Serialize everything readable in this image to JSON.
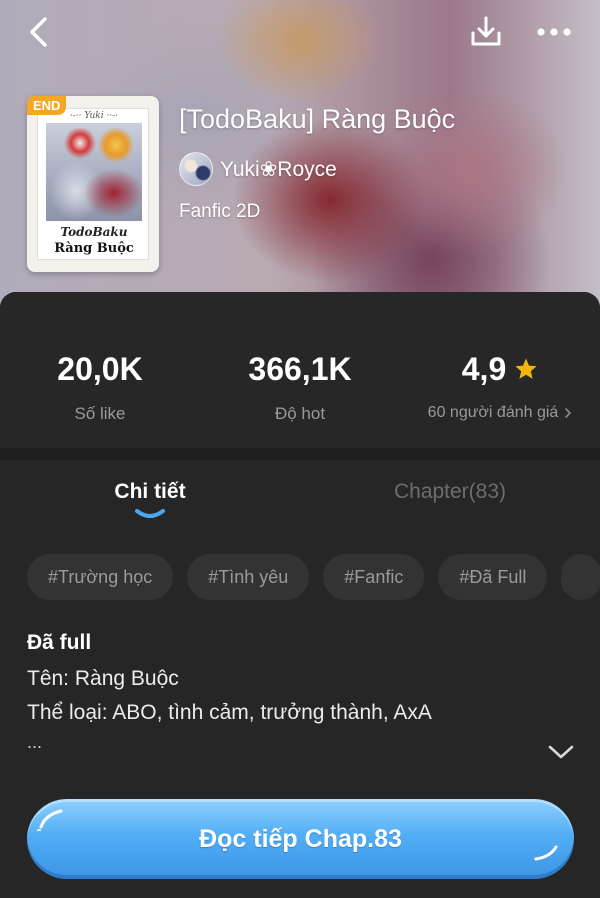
{
  "header": {
    "back_icon": "chevron-left-icon",
    "download_icon": "download-icon",
    "more_icon": "more-horizontal-icon"
  },
  "book": {
    "badge": "END",
    "cover_author": "Yuki",
    "cover_title_line1": "TodoBaku",
    "cover_title_line2": "Ràng Buộc",
    "title": "[TodoBaku] Ràng Buộc",
    "author": "Yuki❀Royce",
    "category": "Fanfic 2D"
  },
  "stats": {
    "likes_value": "20,0K",
    "likes_label": "Số like",
    "hot_value": "366,1K",
    "hot_label": "Độ hot",
    "rating_value": "4,9",
    "rating_label": "60 người đánh giá",
    "rating_icon": "star-icon",
    "rating_color": "#f5b50a"
  },
  "tabs": [
    {
      "label": "Chi tiết",
      "active": true
    },
    {
      "label": "Chapter(83)",
      "active": false
    }
  ],
  "tags": [
    "#Trường học",
    "#Tình yêu",
    "#Fanfic",
    "#Đã Full"
  ],
  "description": {
    "status": "Đã full",
    "lines": [
      "Tên: Ràng Buộc",
      "Thể loại: ABO, tình cảm, trưởng thành, AxA"
    ],
    "ellipsis": "...",
    "expand_icon": "chevron-down-icon"
  },
  "cta": {
    "label": "Đọc tiếp Chap.83",
    "color": "#4aa8f2"
  },
  "colors": {
    "badge": "#f5a623",
    "panel": "#262626",
    "accent_blue": "#4aa8f2"
  }
}
